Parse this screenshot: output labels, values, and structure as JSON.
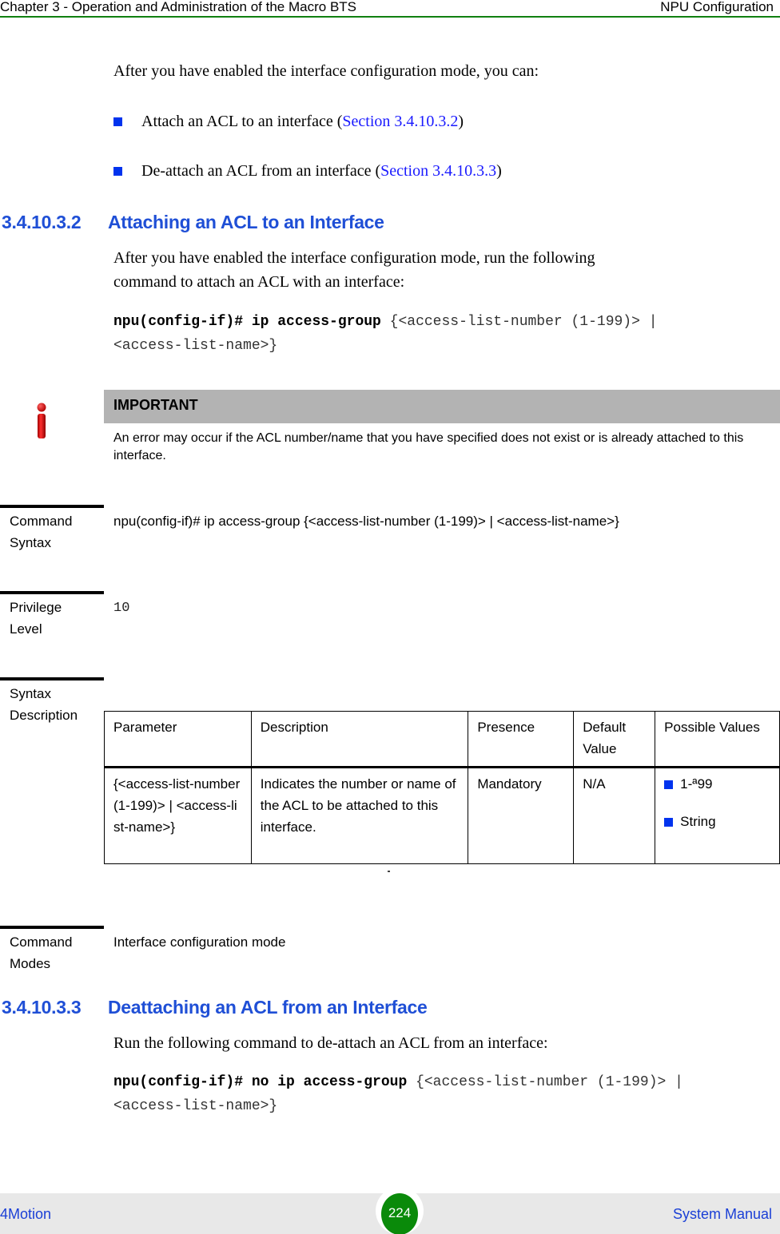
{
  "header": {
    "chapter": "Chapter 3 - Operation and Administration of the Macro BTS",
    "section": "NPU Configuration"
  },
  "intro": {
    "text": "After you have enabled the interface configuration mode, you can:",
    "bullets": [
      {
        "text": "Attach an ACL to an interface (",
        "link": "Section 3.4.10.3.2",
        "suffix": ")"
      },
      {
        "text": "De-attach an ACL from an interface (",
        "link": "Section 3.4.10.3.3",
        "suffix": ")"
      }
    ]
  },
  "section_attach": {
    "number": "3.4.10.3.2",
    "title": "Attaching an ACL to an Interface",
    "para_line1": "After you have enabled the interface configuration mode, run the following",
    "para_line2": "command to attach an ACL with an interface:",
    "command_bold": "npu(config-if)# ip access-group",
    "command_args_line1": " {<access-list-number (1-199)> |",
    "command_args_line2": "<access-list-name>}"
  },
  "important": {
    "icon": "info-icon",
    "title": "IMPORTANT",
    "text": "An error may occur if the ACL number/name that you have specified does not exist or is already attached to this interface."
  },
  "command_syntax": {
    "label_line1": "Command",
    "label_line2": "Syntax",
    "value": "npu(config-if)# ip access-group {<access-list-number (1-199)> | <access-list-name>}"
  },
  "privilege_level": {
    "label_line1": "Privilege",
    "label_line2": "Level",
    "value": "10"
  },
  "syntax_description": {
    "label_line1": "Syntax",
    "label_line2": "Description",
    "columns": [
      "Parameter",
      "Description",
      "Presence",
      "Default Value",
      "Possible Values"
    ],
    "rows": [
      {
        "parameter": "{<access-list-number (1-199)> | <access-list-name>}",
        "description": "Indicates the number or name of the ACL to be attached to this interface.",
        "presence": "Mandatory",
        "default": "N/A",
        "possible_values": [
          "1-ª99",
          "String"
        ]
      }
    ]
  },
  "command_modes": {
    "label_line1": "Command",
    "label_line2": "Modes",
    "value": "Interface configuration mode"
  },
  "section_detach": {
    "number": "3.4.10.3.3",
    "title": "Deattaching an ACL from an Interface",
    "para": "Run the following command to de-attach an ACL from an interface:",
    "command_bold": "npu(config-if)# no ip access-group",
    "command_args_line1": " {<access-list-number (1-199)> |",
    "command_args_line2": "<access-list-name>}"
  },
  "footer": {
    "product": "4Motion",
    "page": "224",
    "doc": "System Manual"
  }
}
